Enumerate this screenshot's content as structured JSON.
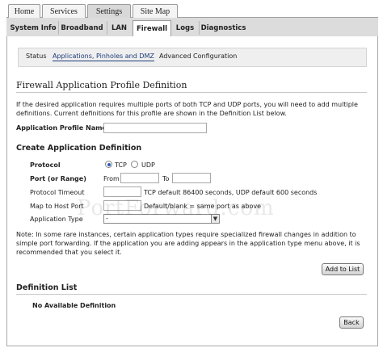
{
  "top_tabs": [
    "Home",
    "Services",
    "Settings",
    "Site Map"
  ],
  "sub_tabs": [
    "System Info",
    "Broadband",
    "LAN",
    "Firewall",
    "Logs",
    "Diagnostics"
  ],
  "inner_nav": [
    "Status",
    "Applications, Pinholes and DMZ",
    "Advanced Configuration"
  ],
  "page_title": "Firewall Application Profile Definition",
  "intro_line1": "If the desired application requires multiple ports of both TCP and UDP ports, you will need to add multiple",
  "intro_line2": "definitions. Current definitions for this profile are shown in the Definition List below.",
  "profile_name_label": "Application Profile Name",
  "profile_name_value": "",
  "create_heading": "Create Application Definition",
  "protocol": {
    "label": "Protocol",
    "tcp": "TCP",
    "udp": "UDP",
    "selected": "TCP"
  },
  "port": {
    "label": "Port (or Range)",
    "from_label": "From",
    "to_label": "To",
    "from_value": "",
    "to_value": ""
  },
  "timeout": {
    "label": "Protocol Timeout",
    "value": "",
    "hint": "TCP default 86400 seconds, UDP default 600 seconds"
  },
  "map_host": {
    "label": "Map to Host Port",
    "value": "",
    "hint": "Default/blank = same port as above"
  },
  "app_type": {
    "label": "Application Type",
    "selected": "-"
  },
  "note_line1": "Note: In some rare instances, certain application types require specialized firewall changes in addition to",
  "note_line2": "simple port forwarding. If the application you are adding appears in the application type menu above, it is",
  "note_line3": "recommended that you select it.",
  "add_button": "Add to List",
  "def_list_heading": "Definition List",
  "def_list_empty": "No Available Definition",
  "back_button": "Back",
  "watermark": "PortForward.com"
}
